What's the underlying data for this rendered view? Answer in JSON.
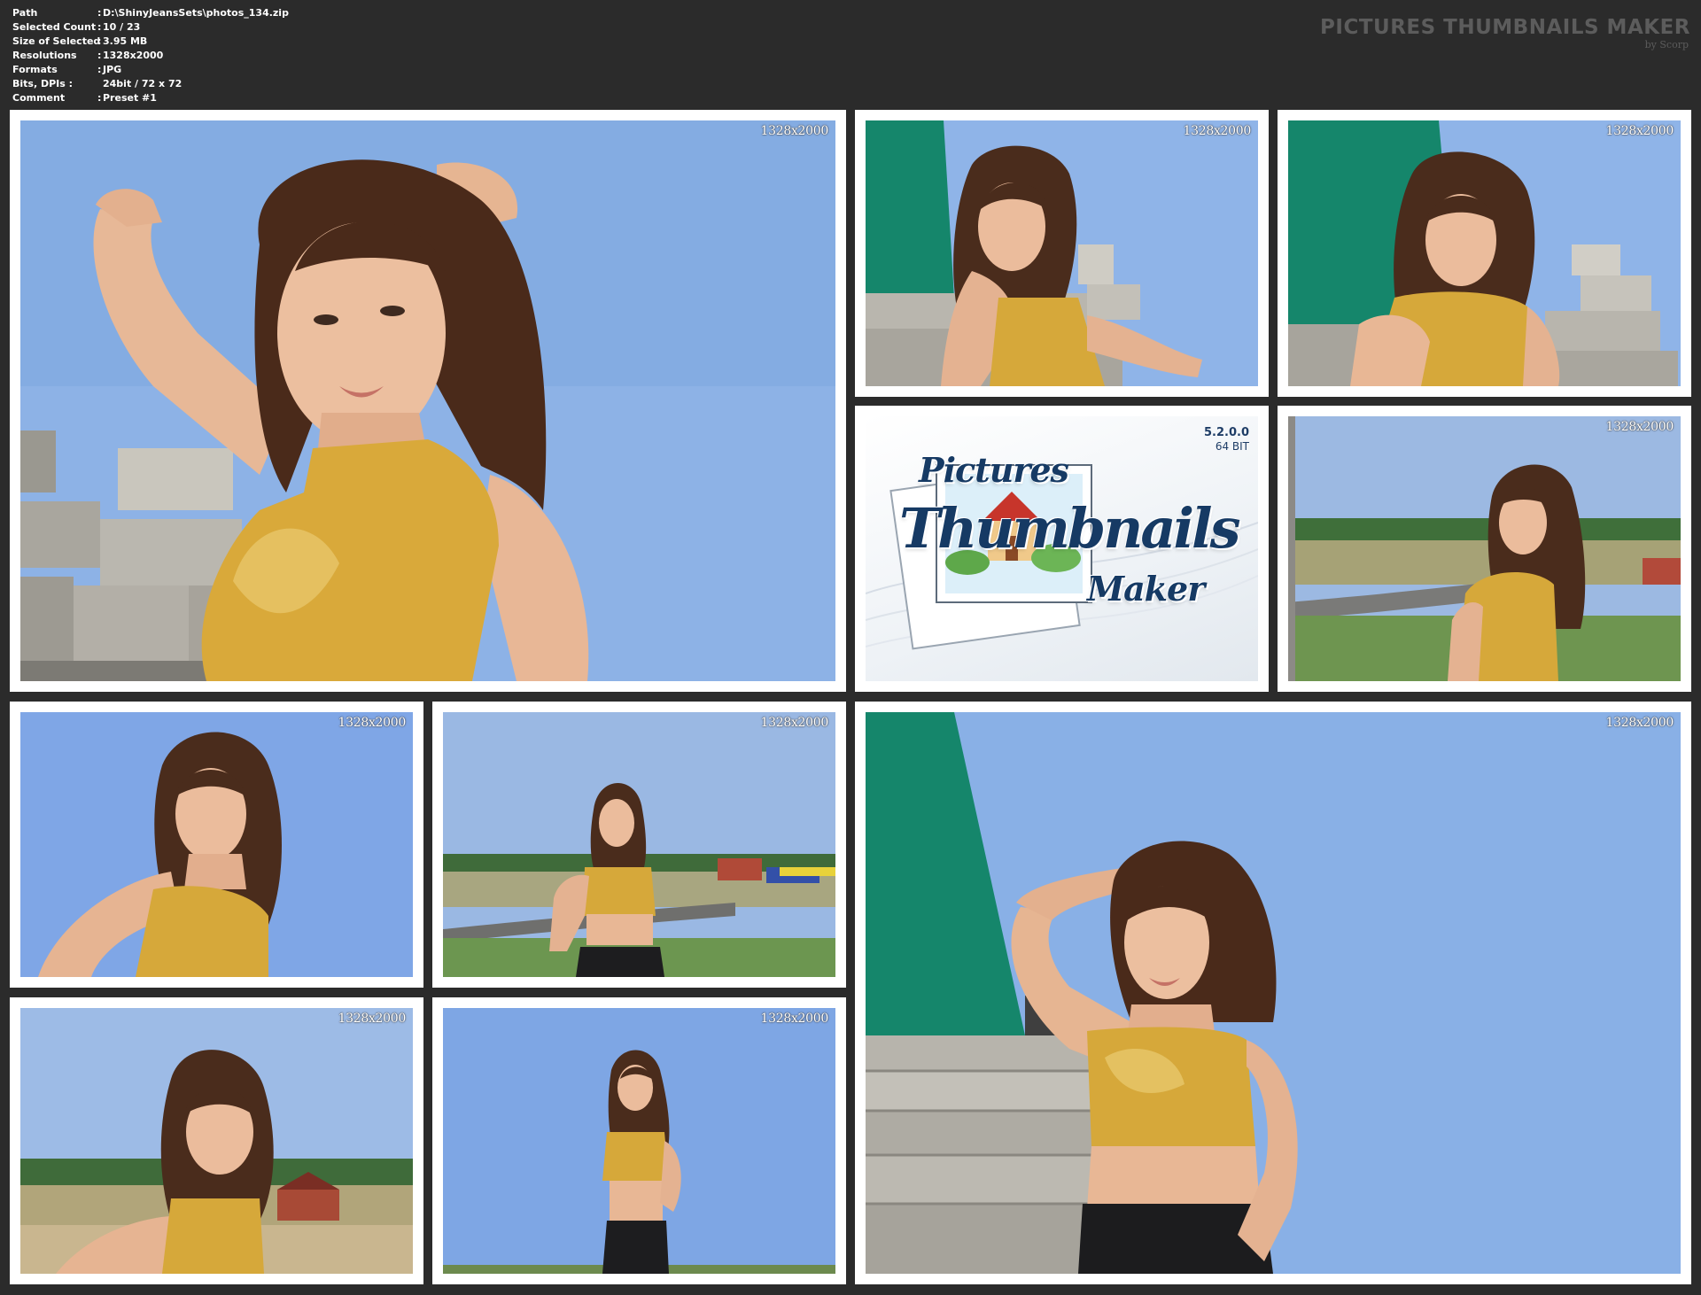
{
  "info": {
    "rows": [
      {
        "label": "Path",
        "value": "D:\\ShinyJeansSets\\photos_134.zip"
      },
      {
        "label": "Selected Count",
        "value": "10 / 23"
      },
      {
        "label": "Size of Selected",
        "value": "3.95 MB"
      },
      {
        "label": "Resolutions",
        "value": "1328x2000"
      },
      {
        "label": "Formats",
        "value": "JPG"
      },
      {
        "label": "Bits, DPIs :",
        "value": "24bit / 72 x 72"
      },
      {
        "label": "Comment",
        "value": "Preset #1"
      }
    ],
    "separator": ":"
  },
  "brand": {
    "title": "PICTURES THUMBNAILS MAKER",
    "subtitle": "by Scorp"
  },
  "thumbnails": [
    {
      "resolution": "1328x2000",
      "scene": "sky-bricks-closeup"
    },
    {
      "resolution": "1328x2000",
      "scene": "green-wall-bricks"
    },
    {
      "resolution": "1328x2000",
      "scene": "green-wall-bricks-2"
    },
    {
      "resolution": "1328x2000",
      "scene": "field-road"
    },
    {
      "resolution": "1328x2000",
      "scene": "sky-portrait"
    },
    {
      "resolution": "1328x2000",
      "scene": "field-village"
    },
    {
      "resolution": "1328x2000",
      "scene": "field-village-2"
    },
    {
      "resolution": "1328x2000",
      "scene": "sky-full"
    },
    {
      "resolution": "1328x2000",
      "scene": "green-wall-large"
    }
  ],
  "logo": {
    "version": "5.2.0.0",
    "bits": "64 BIT",
    "word1": "Pictures",
    "word2": "Thumbnails",
    "word3": "Maker"
  },
  "colors": {
    "background": "#2b2b2b",
    "card": "#ffffff",
    "sky": "#8fb1e0",
    "top": "#d9ad3c",
    "hair": "#4a2c1c",
    "skin": "#e9b99a",
    "wall_green": "#13846a",
    "brick": "#b9b6b0",
    "grass": "#6f9a4a",
    "logo_text": "#163a64"
  }
}
